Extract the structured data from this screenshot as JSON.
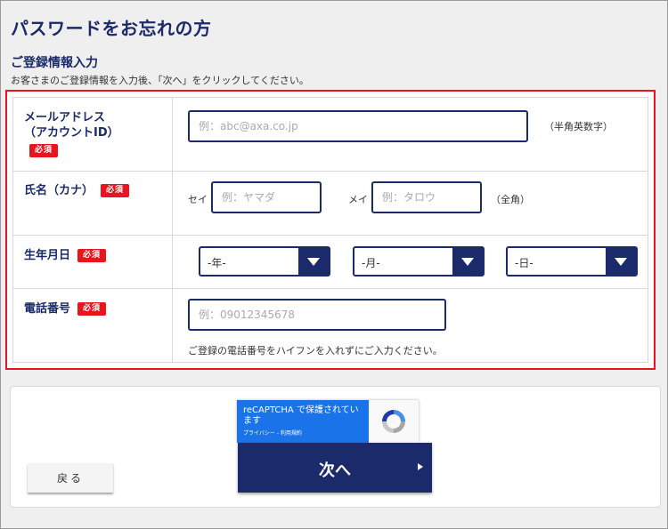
{
  "page": {
    "title": "パスワードをお忘れの方",
    "section_title": "ご登録情報入力",
    "instruction": "お客さまのご登録情報を入力後、「次へ」をクリックしてください。"
  },
  "form": {
    "required_badge": "必須",
    "email": {
      "label_line1": "メールアドレス",
      "label_line2": "（アカウントID）",
      "placeholder": "例：abc@axa.co.jp",
      "value": "",
      "note": "（半角英数字）"
    },
    "name": {
      "label": "氏名（カナ）",
      "sei_label": "セイ",
      "sei_placeholder": "例：ヤマダ",
      "mei_label": "メイ",
      "mei_placeholder": "例：タロウ",
      "note": "（全角）"
    },
    "birthdate": {
      "label": "生年月日",
      "year": "-年-",
      "month": "-月-",
      "day": "-日-"
    },
    "phone": {
      "label": "電話番号",
      "placeholder": "例：09012345678",
      "note": "ご登録の電話番号をハイフンを入れずにご入力ください。"
    }
  },
  "recaptcha": {
    "title": "reCAPTCHA で保護されています",
    "links": "プライバシー - 利用規約",
    "logo_icon": "recaptcha-logo-icon"
  },
  "buttons": {
    "back": "戻る",
    "next": "次へ"
  },
  "colors": {
    "navy": "#1b2a6b",
    "red": "#e8141e",
    "recaptcha_blue": "#1a73e8"
  }
}
